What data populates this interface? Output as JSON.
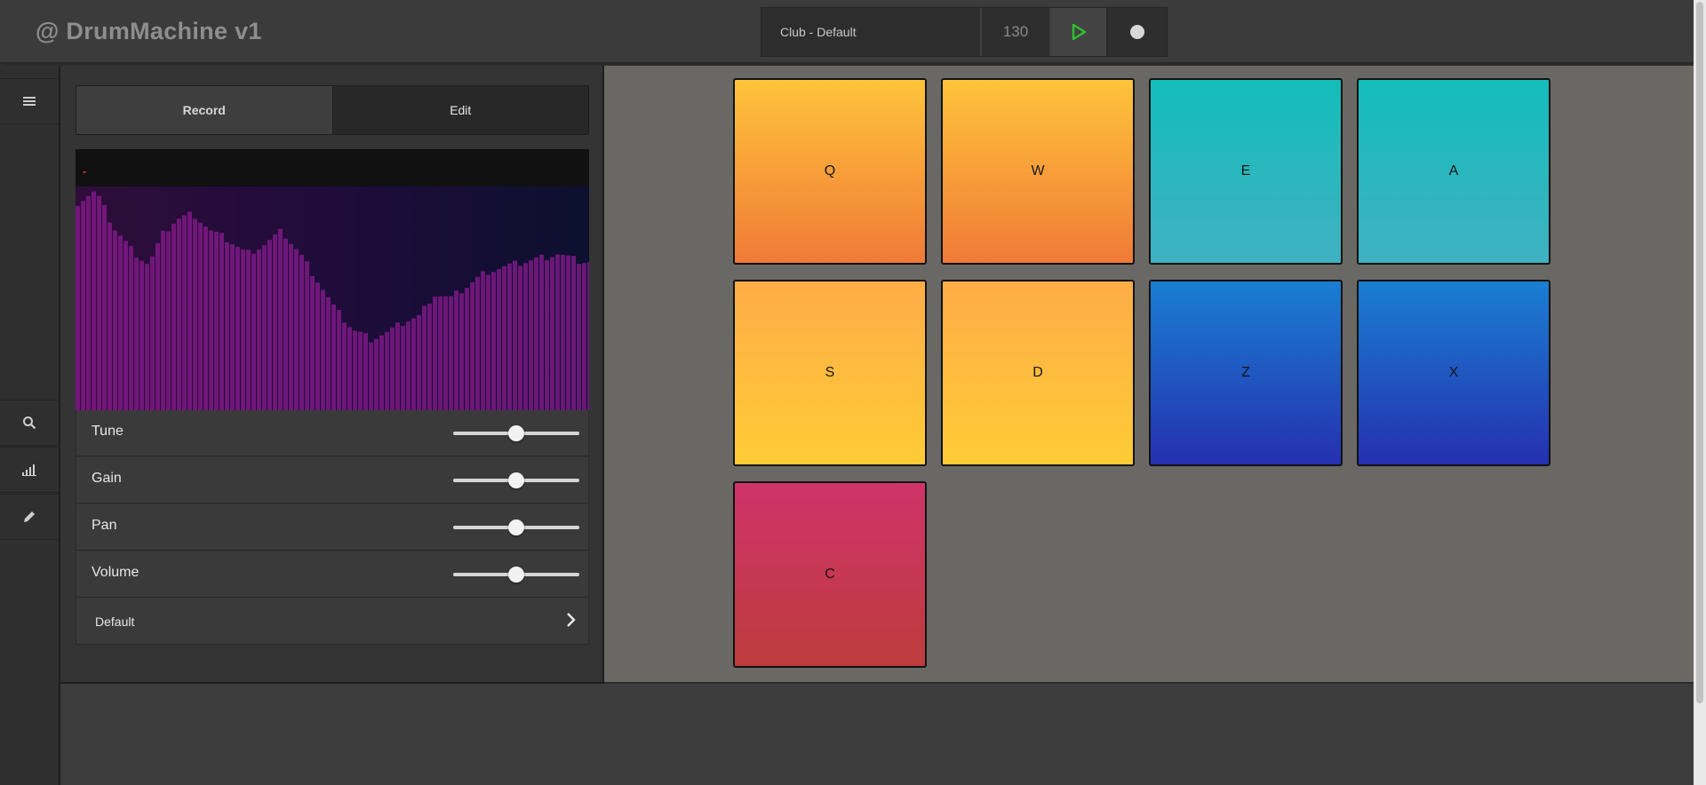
{
  "header": {
    "app_title": "@ DrumMachine v1",
    "kit_name": "Club - Default",
    "bpm": "130",
    "play_icon": "play-icon",
    "record_icon": "record-icon",
    "play_color": "#2ec02e"
  },
  "sidebar": {
    "icons": [
      "menu-icon",
      "search-icon",
      "signal-bars-icon",
      "pencil-icon"
    ]
  },
  "panel": {
    "tabs": [
      {
        "label": "Record",
        "active": true
      },
      {
        "label": "Edit",
        "active": false
      }
    ],
    "waveform": {
      "marker": "-",
      "color": "#8a1b8f"
    },
    "controls": [
      {
        "label": "Tune",
        "value": 0.5
      },
      {
        "label": "Gain",
        "value": 0.5
      },
      {
        "label": "Pan",
        "value": 0.5
      },
      {
        "label": "Volume",
        "value": 0.5
      }
    ],
    "preset": {
      "label": "Default"
    }
  },
  "pads": [
    {
      "key": "Q",
      "color_top": "#ffc43a",
      "color_bottom": "#f07a38"
    },
    {
      "key": "W",
      "color_top": "#ffc43a",
      "color_bottom": "#f07a38"
    },
    {
      "key": "E",
      "color_top": "#13bdb9",
      "color_bottom": "#40b1c2"
    },
    {
      "key": "A",
      "color_top": "#13bdb9",
      "color_bottom": "#40b1c2"
    },
    {
      "key": "S",
      "color_top": "#ffad47",
      "color_bottom": "#ffcb36"
    },
    {
      "key": "D",
      "color_top": "#ffad47",
      "color_bottom": "#ffcb36"
    },
    {
      "key": "Z",
      "color_top": "#1a7ed1",
      "color_bottom": "#2530b0"
    },
    {
      "key": "X",
      "color_top": "#1a7ed1",
      "color_bottom": "#2530b0"
    },
    {
      "key": "C",
      "color_top": "#cf336a",
      "color_bottom": "#bd3c3c"
    }
  ]
}
